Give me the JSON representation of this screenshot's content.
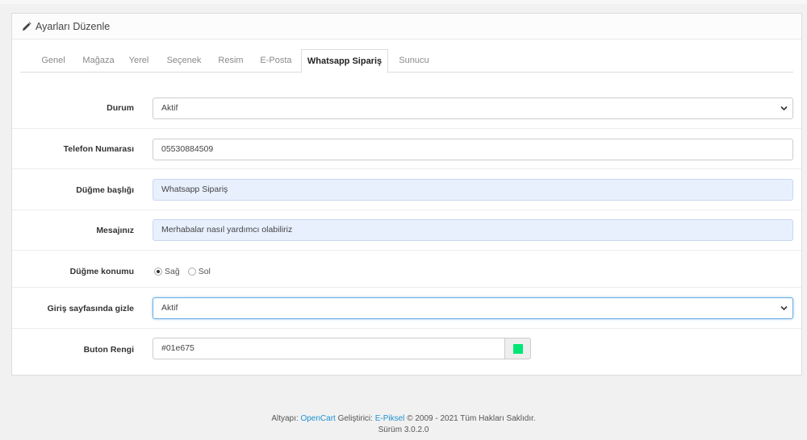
{
  "panel": {
    "title": "Ayarları Düzenle"
  },
  "tabs": [
    {
      "label": "Genel"
    },
    {
      "label": "Mağaza"
    },
    {
      "label": "Yerel"
    },
    {
      "label": "Seçenek"
    },
    {
      "label": "Resim"
    },
    {
      "label": "E-Posta"
    },
    {
      "label": "Whatsapp Sipariş"
    },
    {
      "label": "Sunucu"
    }
  ],
  "active_tab": "Whatsapp Sipariş",
  "form": {
    "durum": {
      "label": "Durum",
      "value": "Aktif"
    },
    "telefon": {
      "label": "Telefon Numarası",
      "value": "05530884509"
    },
    "dugme_basligi": {
      "label": "Düğme başlığı",
      "value": "Whatsapp Sipariş"
    },
    "mesaj": {
      "label": "Mesajınız",
      "value": "Merhabalar nasıl yardımcı olabiliriz"
    },
    "dugme_konumu": {
      "label": "Düğme konumu",
      "options": [
        "Sağ",
        "Sol"
      ],
      "selected": "Sağ"
    },
    "giris_gizle": {
      "label": "Giriş sayfasında gizle",
      "value": "Aktif"
    },
    "buton_rengi": {
      "label": "Buton Rengi",
      "value": "#01e675",
      "swatch_color": "#01e675"
    }
  },
  "footer": {
    "prefix": "Altyapı:",
    "opencart": "OpenCart",
    "dev_label": "Geliştirici:",
    "developer": "E-Piksel",
    "copyright": "© 2009 - 2021 Tüm Hakları Saklıdır.",
    "version": "Sürüm 3.0.2.0"
  }
}
